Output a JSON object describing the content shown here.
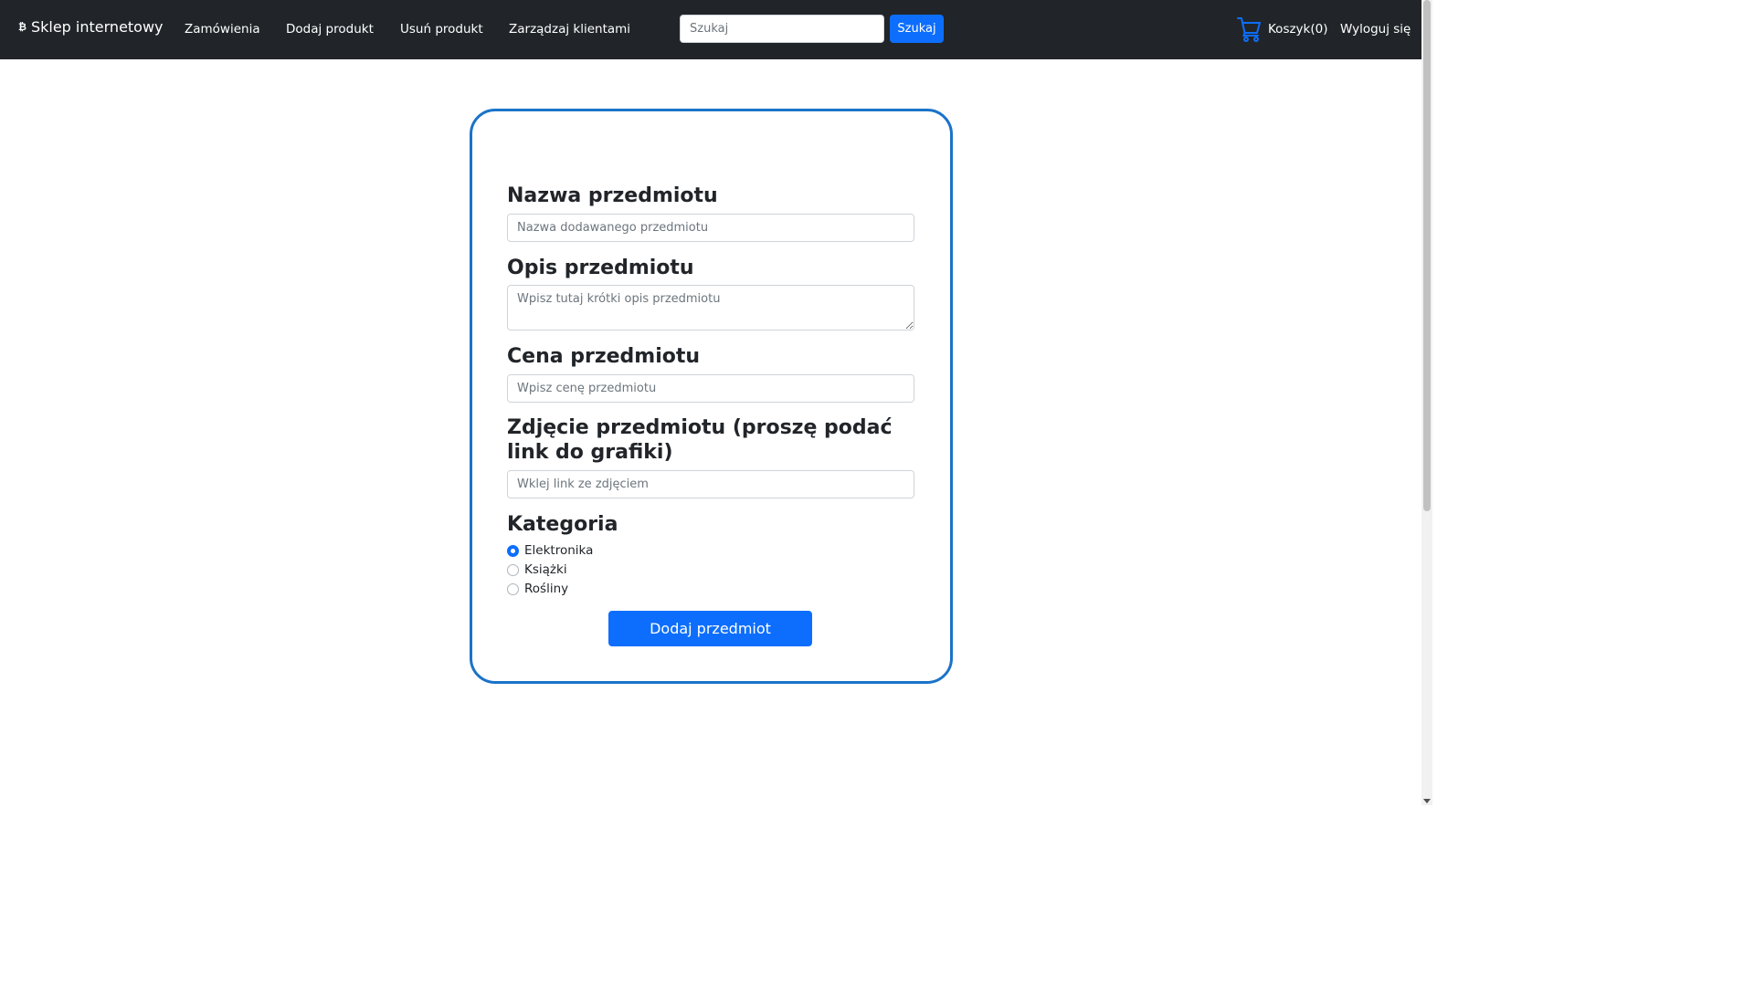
{
  "navbar": {
    "brand_icon": "bitcoin-icon",
    "brand": "Sklep internetowy",
    "links": [
      "Zamówienia",
      "Dodaj produkt",
      "Usuń produkt",
      "Zarządzaj klientami"
    ],
    "search_placeholder": "Szukaj",
    "search_button": "Szukaj",
    "cart_icon": "cart-icon",
    "cart_label": "Koszyk(0)",
    "logout": "Wyloguj się",
    "background": "#212529",
    "accent": "#0d6efd"
  },
  "form": {
    "name_label": "Nazwa przedmiotu",
    "name_placeholder": "Nazwa dodawanego przedmiotu",
    "description_label": "Opis przedmiotu",
    "description_placeholder": "Wpisz tutaj krótki opis przedmiotu",
    "price_label": "Cena przedmiotu",
    "price_placeholder": "Wpisz cenę przedmiotu",
    "image_label": "Zdjęcie przedmiotu (proszę podać link do grafiki)",
    "image_placeholder": "Wklej link ze zdjęciem",
    "category_label": "Kategoria",
    "categories": [
      {
        "label": "Elektronika",
        "checked": true
      },
      {
        "label": "Książki",
        "checked": false
      },
      {
        "label": "Rośliny",
        "checked": false
      }
    ],
    "submit": "Dodaj przedmiot",
    "border_color": "#1a73c8"
  }
}
